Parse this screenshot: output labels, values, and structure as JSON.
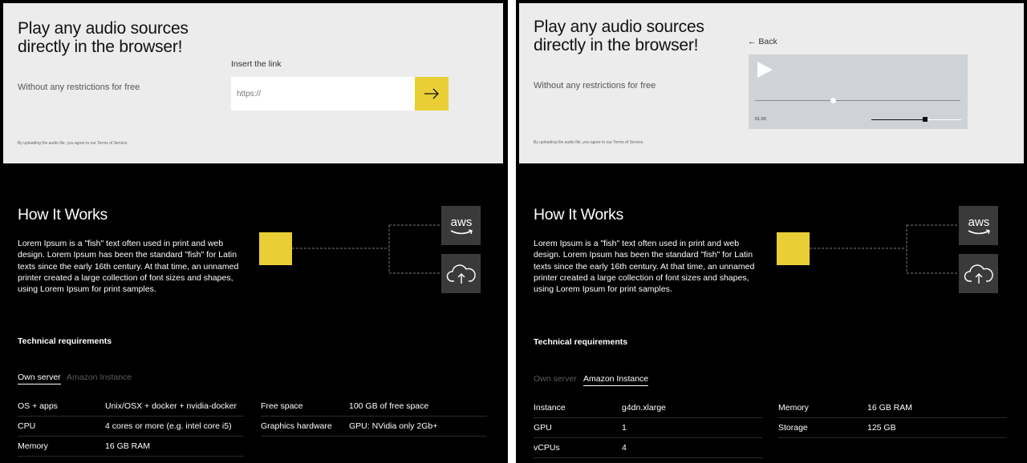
{
  "hero": {
    "title": "Play any audio sources directly in the browser!",
    "subtitle": "Without any restrictions for free",
    "terms": "By uploading the audio file, you agree to our Terms of Service."
  },
  "upload": {
    "label": "Insert the link",
    "placeholder": "https://",
    "submit_icon": "arrow-right-icon"
  },
  "player": {
    "back_label": "← Back",
    "time": "01:00",
    "progress": 0.38,
    "volume": 0.6
  },
  "how_it_works": {
    "title": "How It Works",
    "text": "Lorem Ipsum is a \"fish\" text often used in print and web design. Lorem Ipsum has been the standard \"fish\" for Latin texts since the early 16th century. At that time, an unnamed printer created a large collection of font sizes and shapes, using Lorem Ipsum for print samples.",
    "providers": [
      {
        "icon": "aws-logo-icon",
        "label": "aws"
      },
      {
        "icon": "cloud-upload-icon"
      }
    ],
    "accent_color": "#e9cf35"
  },
  "tech": {
    "title": "Technical requirements",
    "tabs": [
      "Own server",
      "Amazon Instance"
    ],
    "own_server": [
      {
        "label": "OS + apps",
        "value": "Unix/OSX + docker + nvidia-docker"
      },
      {
        "label": "CPU",
        "value": "4 cores or more (e.g. intel core i5)"
      },
      {
        "label": "Memory",
        "value": "16 GB RAM"
      },
      {
        "label": "Free space",
        "value": "100 GB of free space"
      },
      {
        "label": "Graphics hardware",
        "value": "GPU: NVidia only 2Gb+"
      }
    ],
    "amazon_instance": [
      {
        "label": "Instance",
        "value": "g4dn.xlarge"
      },
      {
        "label": "GPU",
        "value": "1"
      },
      {
        "label": "vCPUs",
        "value": "4"
      },
      {
        "label": "Memory",
        "value": "16 GB RAM"
      },
      {
        "label": "Storage",
        "value": "125 GB"
      }
    ]
  }
}
